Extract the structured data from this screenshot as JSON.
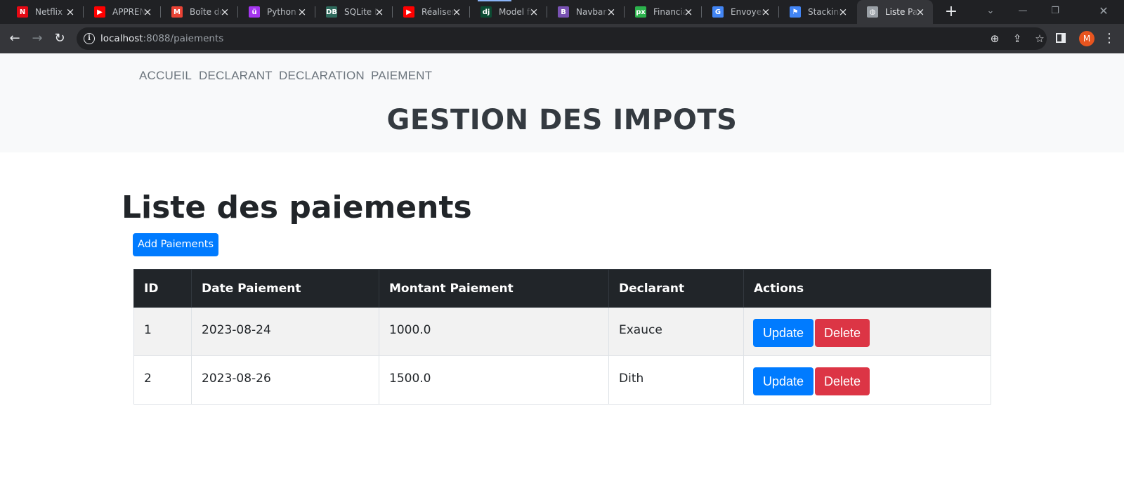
{
  "browser": {
    "tabs": [
      {
        "title": "Netflix",
        "icon": "netflix-icon",
        "color": "#e50914",
        "glyph": "N"
      },
      {
        "title": "APPRENDRE",
        "icon": "youtube-icon",
        "color": "#ff0000",
        "glyph": "▶"
      },
      {
        "title": "Boîte de réception",
        "icon": "gmail-icon",
        "color": "#ea4335",
        "glyph": "M"
      },
      {
        "title": "Python & Django",
        "icon": "udemy-icon",
        "color": "#a435f0",
        "glyph": "ü"
      },
      {
        "title": "SQLite DB",
        "icon": "sqlite-icon",
        "color": "#2f6b5d",
        "glyph": "DB"
      },
      {
        "title": "Réaliser une",
        "icon": "youtube-icon",
        "color": "#ff0000",
        "glyph": "▶"
      },
      {
        "title": "Model field",
        "icon": "django-icon",
        "color": "#0c4b33",
        "glyph": "dj"
      },
      {
        "title": "Navbar · Bootstrap",
        "icon": "bootstrap-icon",
        "color": "#7952b3",
        "glyph": "B"
      },
      {
        "title": "Financial",
        "icon": "px-icon",
        "color": "#2bb24c",
        "glyph": "px"
      },
      {
        "title": "Envoyer",
        "icon": "google-icon",
        "color": "#4285f4",
        "glyph": "G"
      },
      {
        "title": "Stacking",
        "icon": "flag-icon",
        "color": "#4285f4",
        "glyph": "⚑"
      },
      {
        "title": "Liste Paiements",
        "icon": "globe-icon",
        "color": "#9aa0a6",
        "glyph": "◍"
      }
    ],
    "active_tab_index": 11,
    "url_host": "localhost",
    "url_rest": ":8088/paiements",
    "profile_initial": "M"
  },
  "site": {
    "nav": [
      "ACCUEIL",
      "DECLARANT",
      "DECLARATION",
      "PAIEMENT"
    ],
    "title": "GESTION DES IMPOTS"
  },
  "main": {
    "heading": "Liste des paiements",
    "add_button": "Add Paiements",
    "table": {
      "headers": [
        "ID",
        "Date Paiement",
        "Montant Paiement",
        "Declarant",
        "Actions"
      ],
      "rows": [
        {
          "id": "1",
          "date": "2023-08-24",
          "montant": "1000.0",
          "declarant": "Exauce"
        },
        {
          "id": "2",
          "date": "2023-08-26",
          "montant": "1500.0",
          "declarant": "Dith"
        }
      ],
      "update_label": "Update",
      "delete_label": "Delete"
    }
  },
  "colors": {
    "primary": "#007bff",
    "danger": "#dc3545",
    "header_bg": "#f8f9fa",
    "table_head": "#212529"
  }
}
